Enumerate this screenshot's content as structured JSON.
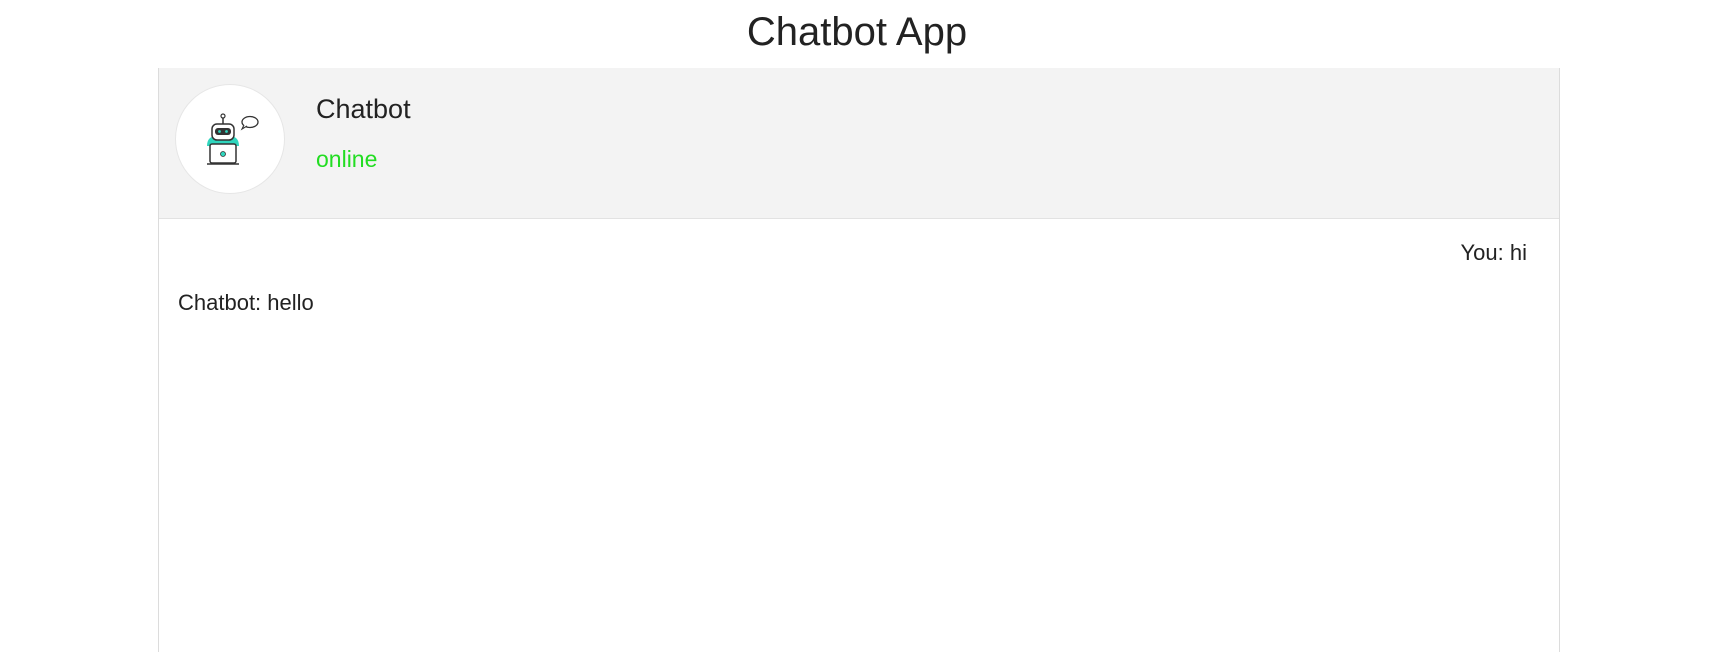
{
  "app": {
    "title": "Chatbot App"
  },
  "header": {
    "bot_name": "Chatbot",
    "status": "online",
    "status_color": "#22dd22",
    "avatar_icon": "robot-icon",
    "avatar_accent": "#2fd5bd"
  },
  "messages": [
    {
      "sender": "user",
      "text": "You: hi"
    },
    {
      "sender": "bot",
      "text": "Chatbot: hello"
    }
  ]
}
